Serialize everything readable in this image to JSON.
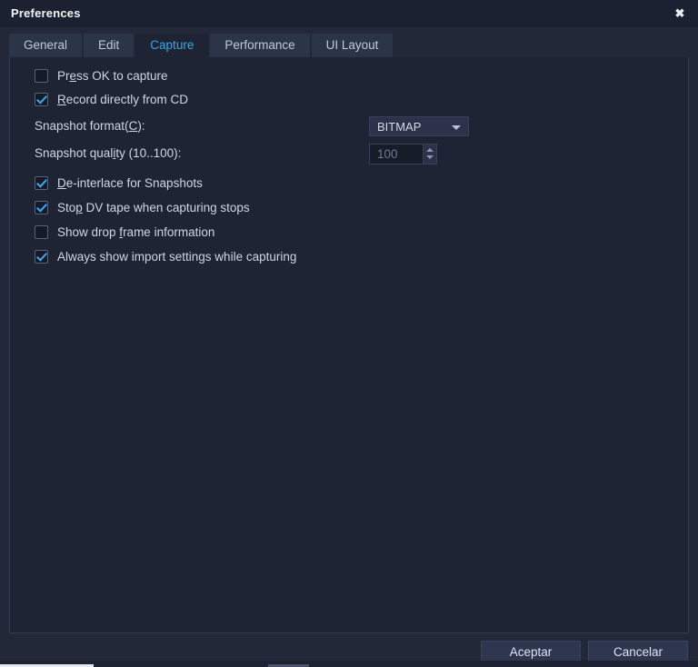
{
  "window": {
    "title": "Preferences",
    "close_icon": "close-icon",
    "close_glyph": "✖"
  },
  "tabs": [
    {
      "label": "General",
      "active": false
    },
    {
      "label": "Edit",
      "active": false
    },
    {
      "label": "Capture",
      "active": true
    },
    {
      "label": "Performance",
      "active": false
    },
    {
      "label": "UI Layout",
      "active": false
    }
  ],
  "capture_panel": {
    "options_top": [
      {
        "label": "Press OK to capture",
        "mnemonic_index": 2,
        "checked": false
      },
      {
        "label": "Record directly from CD",
        "mnemonic_index": 0,
        "checked": true
      }
    ],
    "format_field": {
      "label": "Snapshot format(C):",
      "mnemonic_index": 16,
      "value": "BITMAP",
      "arrow_icon": "chevron-down-icon"
    },
    "quality_field": {
      "label": "Snapshot quality (10..100):",
      "mnemonic_index": 13,
      "value": "100",
      "enabled": false,
      "up_icon": "spinner-up-icon",
      "down_icon": "spinner-down-icon"
    },
    "options_bottom": [
      {
        "label": "De-interlace for Snapshots",
        "mnemonic_index": 0,
        "checked": true
      },
      {
        "label": "Stop DV tape when capturing stops",
        "mnemonic_index": 3,
        "checked": true
      },
      {
        "label": "Show drop frame information",
        "mnemonic_index": 10,
        "checked": false
      },
      {
        "label": "Always show import settings while capturing",
        "mnemonic_index": -1,
        "checked": true
      }
    ]
  },
  "footer": {
    "accept_label": "Aceptar",
    "cancel_label": "Cancelar"
  },
  "colors": {
    "accent": "#36a6e8",
    "window_bg": "#222838",
    "titlebar_bg": "#1b2130",
    "panel_bg": "#1e2433",
    "tab_bg": "#2c3448",
    "text": "#cfd6e2"
  }
}
